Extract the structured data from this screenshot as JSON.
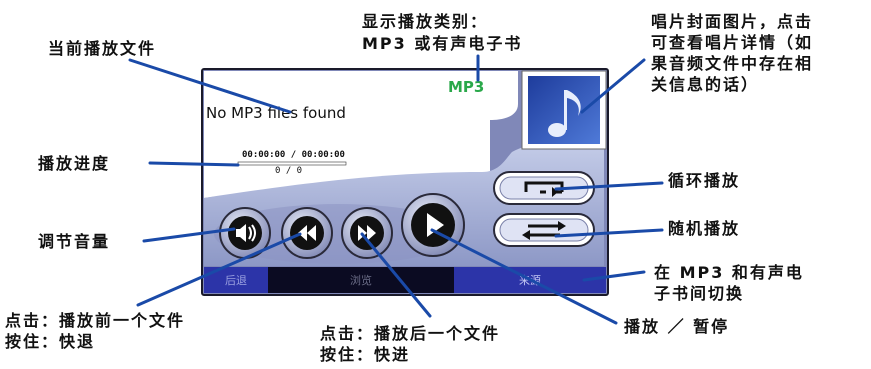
{
  "annotations": {
    "current_file": "当前播放文件",
    "category_line1": "显示播放类别：",
    "category_line2": "MP3 或有声电子书",
    "cover_art": "唱片封面图片，点击\n可查看唱片详情（如\n果音频文件中存在相\n关信息的话）",
    "progress": "播放进度",
    "repeat": "循环播放",
    "shuffle": "随机播放",
    "volume": "调节音量",
    "switch_source": "在 MP3 和有声电\n子书间切换",
    "previous": "点击：播放前一个文件\n按住：快退",
    "next": "点击：播放后一个文件\n按住：快进",
    "play_pause": "播放 ／ 暂停"
  },
  "player": {
    "track_title": "No MP3 files found",
    "category": "MP3",
    "time": "00:00:00 / 00:00:00",
    "track_count": "0 / 0",
    "progress_fraction": 0,
    "tabs": {
      "back": "后退",
      "browse": "浏览",
      "source": "来源"
    }
  },
  "icons": {
    "cover": "music-note-icon",
    "volume": "speaker-icon",
    "previous": "rewind-icon",
    "next": "fast-forward-icon",
    "play": "play-icon",
    "repeat": "repeat-icon",
    "shuffle": "shuffle-icon"
  },
  "colors": {
    "panel": "#aab4d8",
    "tab_bar": "#2c34a8",
    "category_text": "#2aa84a",
    "callout_line": "#1a4aa8"
  }
}
